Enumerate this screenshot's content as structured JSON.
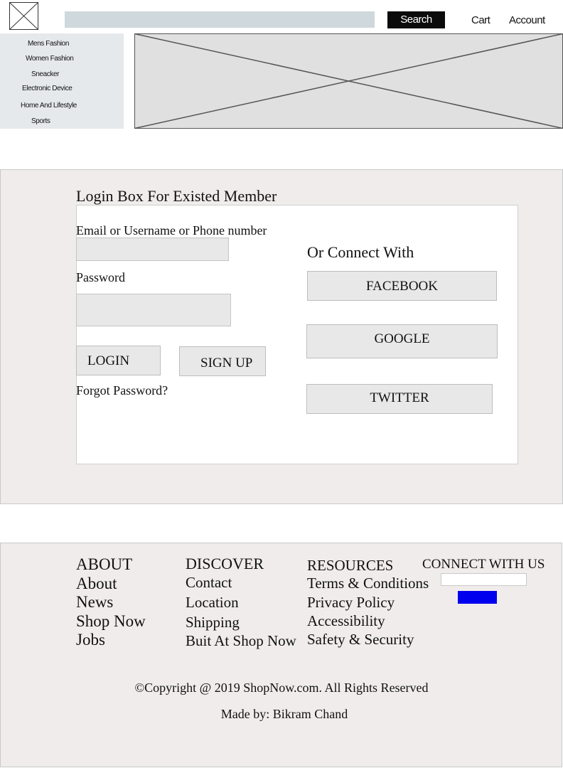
{
  "header": {
    "search_placeholder": "",
    "search_button": "Search",
    "cart": "Cart",
    "account": "Account"
  },
  "sidebar": {
    "items": [
      {
        "label": "Mens Fashion"
      },
      {
        "label": "Women Fashion"
      },
      {
        "label": "Sneacker"
      },
      {
        "label": "Electronic Device"
      },
      {
        "label": "Home And Lifestyle"
      },
      {
        "label": "Sports"
      }
    ]
  },
  "login": {
    "title": "Login Box For Existed Member",
    "email_label": "Email or Username or Phone number",
    "password_label": "Password",
    "login_button": "LOGIN",
    "signup_button": "SIGN UP",
    "forgot": "Forgot Password?",
    "connect_title": "Or Connect With",
    "facebook": "FACEBOOK",
    "google": "GOOGLE",
    "twitter": "TWITTER"
  },
  "footer": {
    "about": {
      "heading": "ABOUT",
      "links": [
        "About",
        "News",
        "Shop Now",
        "Jobs"
      ]
    },
    "discover": {
      "heading": "DISCOVER",
      "links": [
        "Contact",
        "Location",
        "Shipping",
        "Buit At Shop Now"
      ]
    },
    "resources": {
      "heading": "RESOURCES",
      "links": [
        "Terms & Conditions",
        "Privacy Policy",
        "Accessibility",
        "Safety & Security"
      ]
    },
    "connect": {
      "heading": "CONNECT WITH US"
    },
    "copyright": "©Copyright @ 2019 ShopNow.com. All Rights Reserved",
    "made_by": "Made by: Bikram Chand"
  },
  "colors": {
    "search_button_bg": "#0b0b0b",
    "search_field_bg": "#cfd8dc",
    "sidebar_bg": "#e5e9ec",
    "section_bg": "#f0ecec",
    "newsletter_button": "#0000ee"
  },
  "icons": {
    "logo": "placeholder-image-icon",
    "banner": "placeholder-image-icon"
  }
}
